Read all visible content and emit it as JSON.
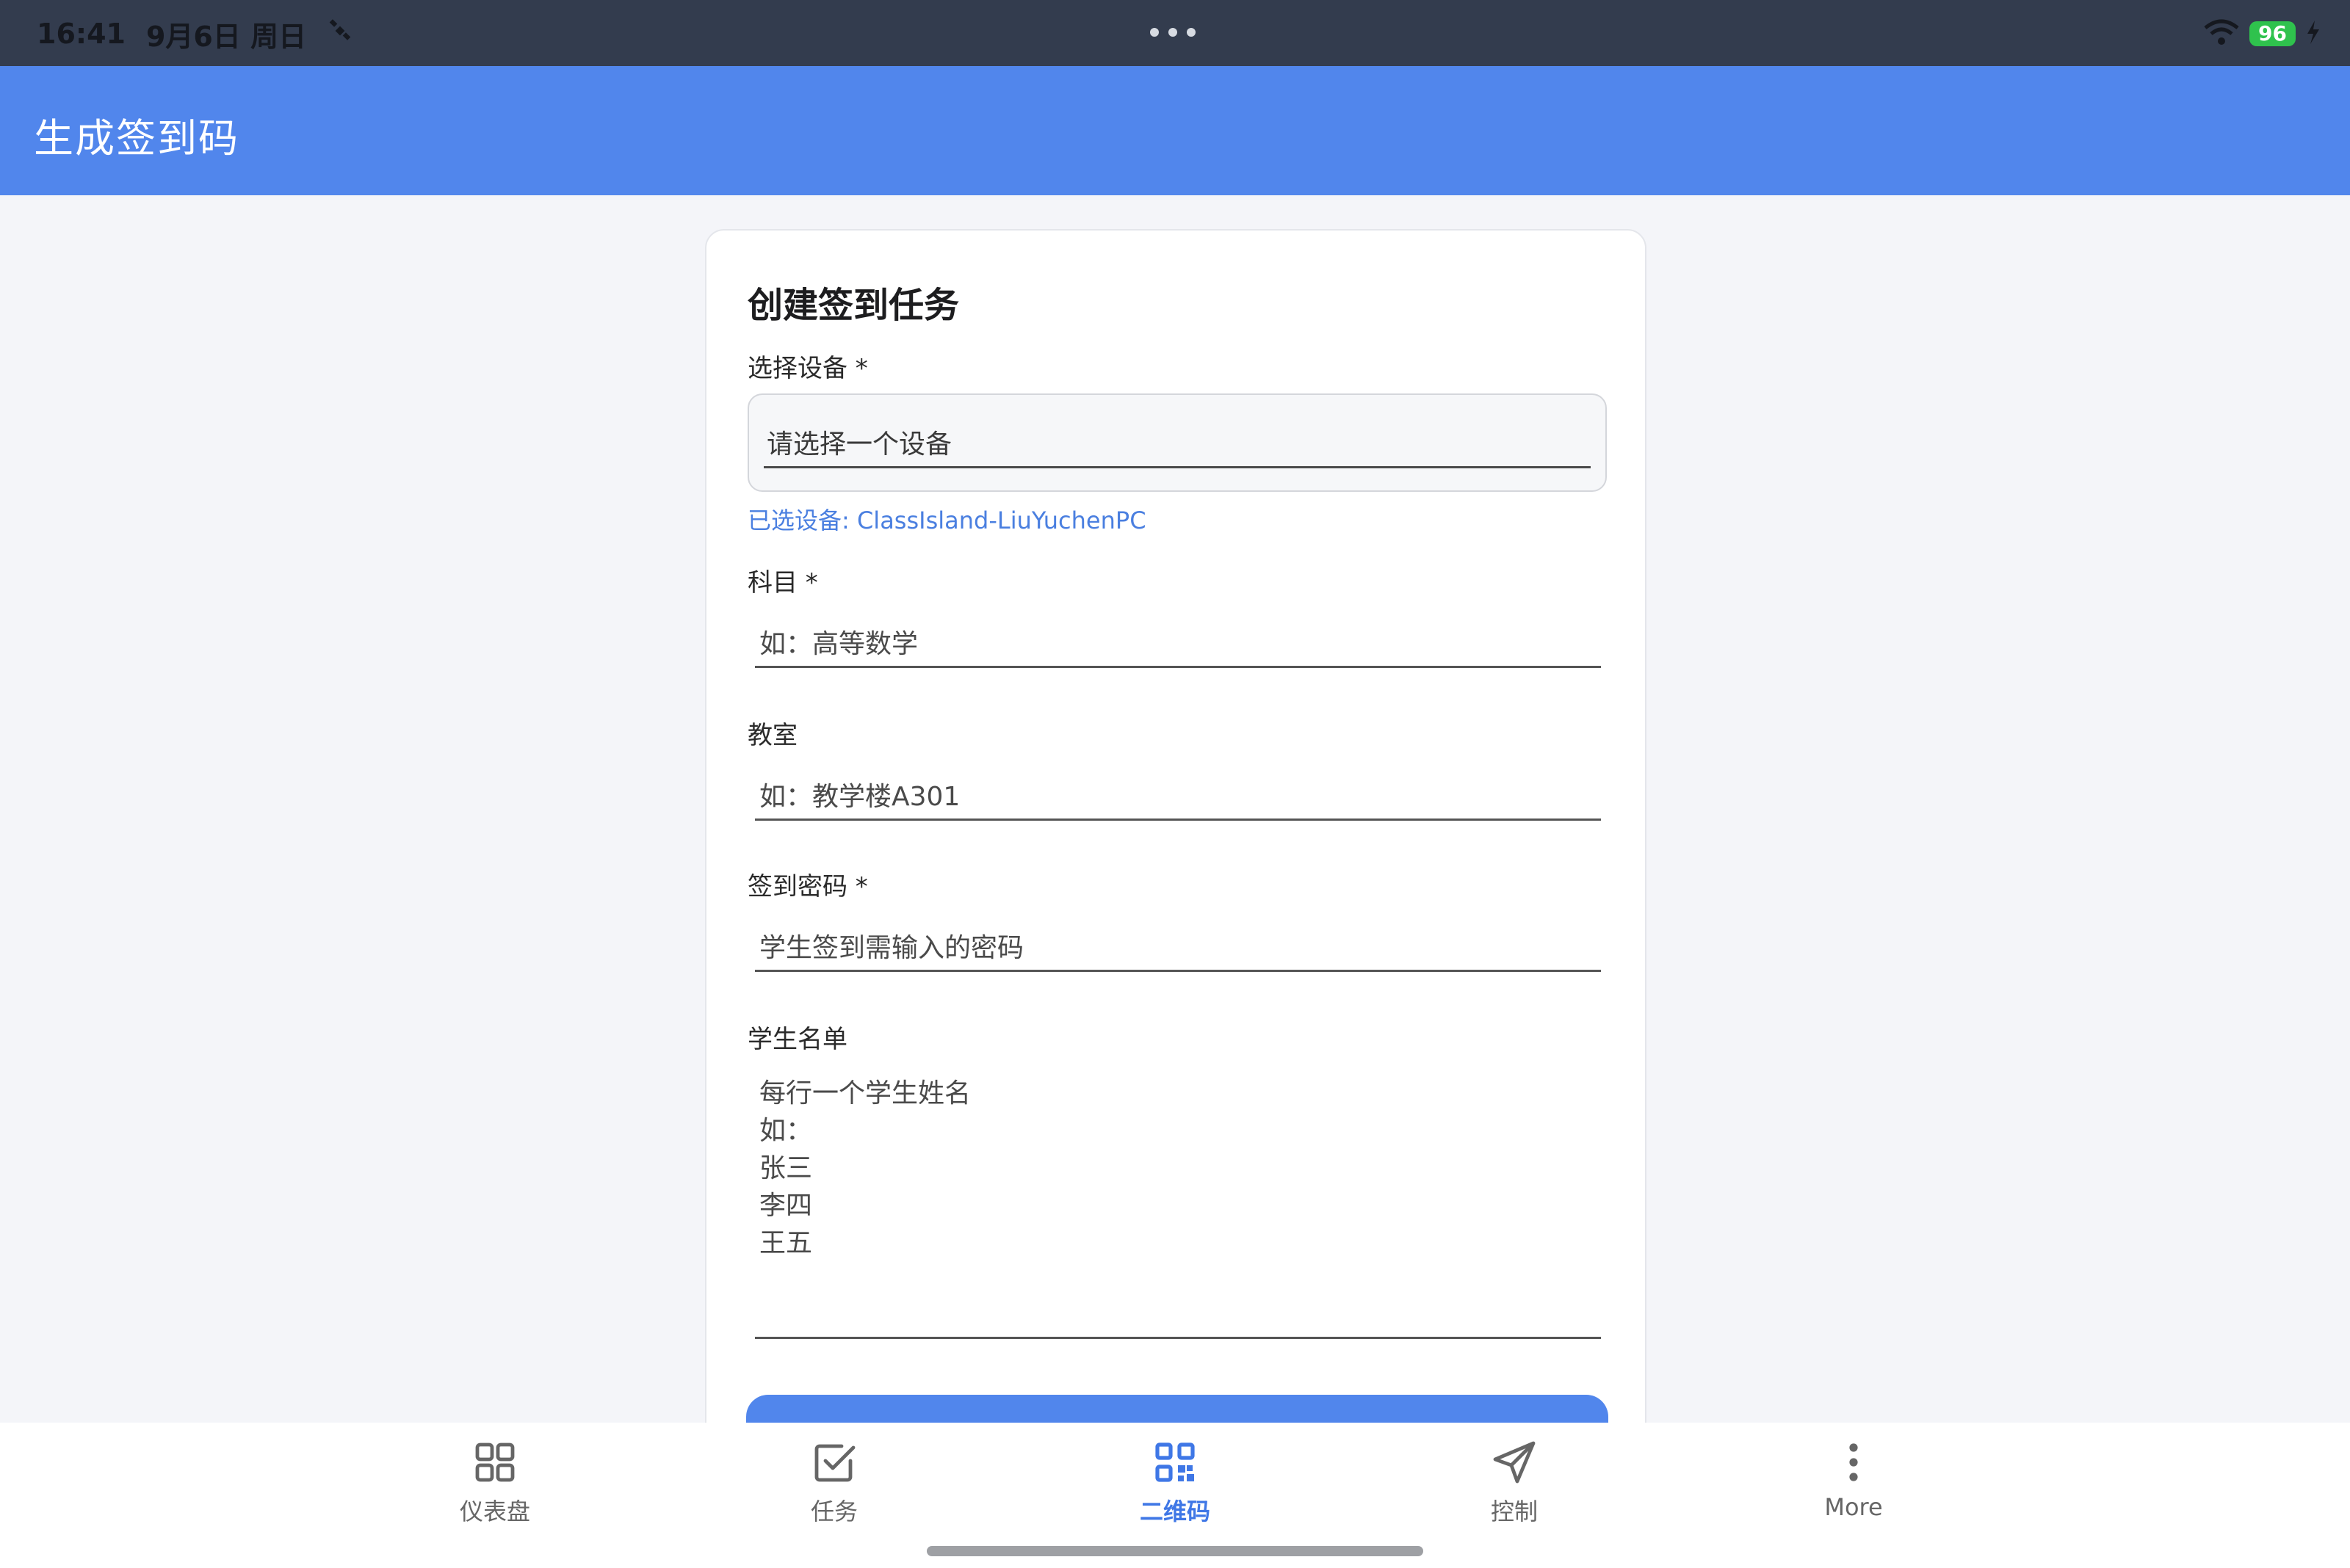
{
  "status_bar": {
    "time": "16:41",
    "date": "9月6日 周日",
    "battery": "96",
    "icons": [
      "satellite-icon",
      "more-dots-icon",
      "wifi-icon",
      "battery-icon",
      "charging-bolt-icon"
    ]
  },
  "app_bar": {
    "title": "生成签到码"
  },
  "form": {
    "title": "创建签到任务",
    "device_label": "选择设备 *",
    "device_placeholder": "请选择一个设备",
    "selected_device": "已选设备: ClassIsland-LiuYuchenPC",
    "subject_label": "科目 *",
    "subject_placeholder": "如：高等数学",
    "classroom_label": "教室",
    "classroom_placeholder": "如：教学楼A301",
    "password_label": "签到密码 *",
    "password_placeholder": "学生签到需输入的密码",
    "students_label": "学生名单",
    "students_placeholder": [
      "每行一个学生姓名",
      "如：",
      "张三",
      "李四",
      "王五"
    ]
  },
  "bottom_nav": {
    "items": [
      {
        "label": "仪表盘",
        "icon": "dashboard-grid-icon"
      },
      {
        "label": "任务",
        "icon": "checkbox-icon"
      },
      {
        "label": "二维码",
        "icon": "qr-code-icon",
        "active": true
      },
      {
        "label": "控制",
        "icon": "send-icon"
      },
      {
        "label": "More",
        "icon": "more-vertical-icon"
      }
    ]
  },
  "colors": {
    "primary": "#5186ec",
    "status_bar": "#333c4e",
    "background": "#f4f5f9",
    "active_nav": "#3f77e6"
  }
}
